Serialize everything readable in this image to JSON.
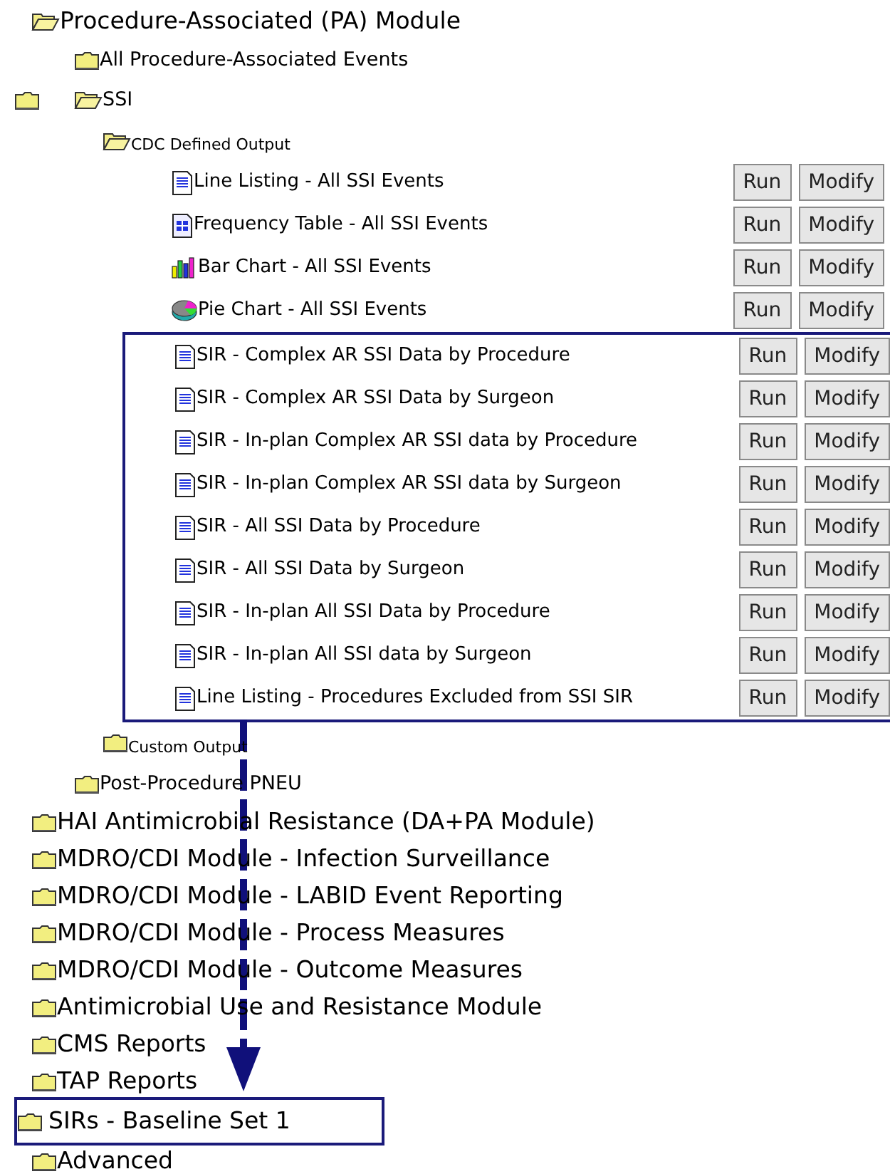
{
  "tree": [
    {
      "label": "Procedure-Associated (PA) Module",
      "expanded": true,
      "children": [
        {
          "label": "All Procedure-Associated Events",
          "expanded": false
        },
        {
          "label": "SSI",
          "expanded": true,
          "leading_folder": true,
          "children": [
            {
              "label": "CDC Defined Output",
              "expanded": true,
              "small": true,
              "reports": [
                {
                  "kind": "list",
                  "label": "Line Listing - All SSI Events",
                  "highlighted": false,
                  "buttons": [
                    "Run",
                    "Modify"
                  ]
                },
                {
                  "kind": "table",
                  "label": "Frequency Table - All SSI Events",
                  "highlighted": false,
                  "buttons": [
                    "Run",
                    "Modify"
                  ]
                },
                {
                  "kind": "bar",
                  "label": "Bar Chart - All SSI Events",
                  "highlighted": false,
                  "buttons": [
                    "Run",
                    "Modify"
                  ]
                },
                {
                  "kind": "pie",
                  "label": "Pie Chart - All SSI Events",
                  "highlighted": false,
                  "buttons": [
                    "Run",
                    "Modify"
                  ]
                },
                {
                  "kind": "list",
                  "label": "SIR - Complex AR SSI Data by Procedure",
                  "highlighted": true,
                  "buttons": [
                    "Run",
                    "Modify"
                  ]
                },
                {
                  "kind": "list",
                  "label": "SIR - Complex AR SSI Data by Surgeon",
                  "highlighted": true,
                  "buttons": [
                    "Run",
                    "Modify"
                  ]
                },
                {
                  "kind": "list",
                  "label": "SIR - In-plan Complex AR SSI data by Procedure",
                  "highlighted": true,
                  "buttons": [
                    "Run",
                    "Modify"
                  ]
                },
                {
                  "kind": "list",
                  "label": "SIR - In-plan Complex AR SSI data by Surgeon",
                  "highlighted": true,
                  "buttons": [
                    "Run",
                    "Modify"
                  ]
                },
                {
                  "kind": "list",
                  "label": "SIR - All SSI Data by Procedure",
                  "highlighted": true,
                  "buttons": [
                    "Run",
                    "Modify"
                  ]
                },
                {
                  "kind": "list",
                  "label": "SIR - All SSI Data by Surgeon",
                  "highlighted": true,
                  "buttons": [
                    "Run",
                    "Modify"
                  ]
                },
                {
                  "kind": "list",
                  "label": "SIR - In-plan All SSI Data by Procedure",
                  "highlighted": true,
                  "buttons": [
                    "Run",
                    "Modify"
                  ]
                },
                {
                  "kind": "list",
                  "label": "SIR - In-plan All SSI data by Surgeon",
                  "highlighted": true,
                  "buttons": [
                    "Run",
                    "Modify"
                  ]
                },
                {
                  "kind": "list",
                  "label": "Line Listing - Procedures Excluded from SSI SIR",
                  "highlighted": true,
                  "buttons": [
                    "Run",
                    "Modify"
                  ]
                }
              ]
            },
            {
              "label": "Custom Output",
              "expanded": false,
              "small": true
            }
          ]
        },
        {
          "label": "Post-Procedure PNEU",
          "expanded": false
        }
      ]
    },
    {
      "label": "HAI Antimicrobial Resistance (DA+PA Module)",
      "expanded": false
    },
    {
      "label": "MDRO/CDI Module - Infection Surveillance",
      "expanded": false
    },
    {
      "label": "MDRO/CDI Module - LABID Event Reporting",
      "expanded": false
    },
    {
      "label": "MDRO/CDI Module - Process Measures",
      "expanded": false
    },
    {
      "label": "MDRO/CDI Module - Outcome Measures",
      "expanded": false
    },
    {
      "label": "Antimicrobial Use and Resistance Module",
      "expanded": false
    },
    {
      "label": "CMS Reports",
      "expanded": false
    },
    {
      "label": "TAP Reports",
      "expanded": false
    },
    {
      "label": "SIRs - Baseline Set 1",
      "expanded": false,
      "boxed": true
    },
    {
      "label": "Advanced",
      "expanded": false
    }
  ]
}
